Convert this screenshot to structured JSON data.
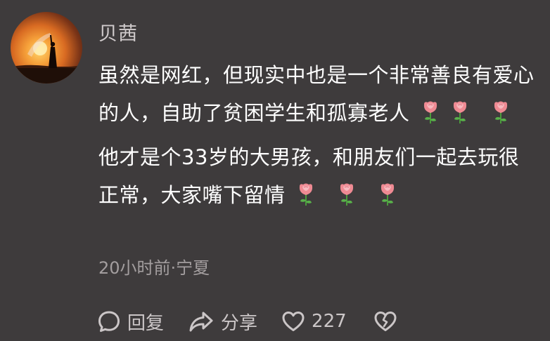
{
  "comment": {
    "username": "贝茜",
    "paragraph1": "虽然是网红，但现实中也是一个非常善良有爱心的人，自助了贫困学生和孤寡老人",
    "paragraph2": "他才是个33岁的大男孩，和朋友们一起去玩很正常，大家嘴下留情",
    "meta": "20小时前·宁夏",
    "emoji": "rose-icon"
  },
  "actions": {
    "reply_label": "回复",
    "share_label": "分享",
    "like_count": "227"
  },
  "colors": {
    "background": "#3e3b3c",
    "text": "#ffffff",
    "username": "#cfcacb",
    "meta": "#a39e9f"
  }
}
